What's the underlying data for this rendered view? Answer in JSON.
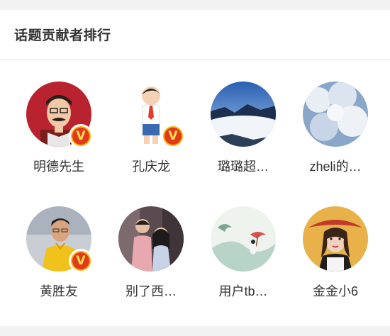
{
  "section": {
    "title": "话题贡献者排行"
  },
  "users": [
    {
      "name": "明德先生",
      "verified": true
    },
    {
      "name": "孔庆龙",
      "verified": true
    },
    {
      "name": "璐璐超…",
      "verified": false
    },
    {
      "name": "zheli的…",
      "verified": false
    },
    {
      "name": "黄胜友",
      "verified": true
    },
    {
      "name": "别了西…",
      "verified": false
    },
    {
      "name": "用户tb…",
      "verified": false
    },
    {
      "name": "金金小6",
      "verified": false
    }
  ],
  "badge": {
    "label": "V"
  },
  "colors": {
    "badge_ring": "#ffb000",
    "badge_fill": "#e0391d",
    "text": "#333333"
  }
}
